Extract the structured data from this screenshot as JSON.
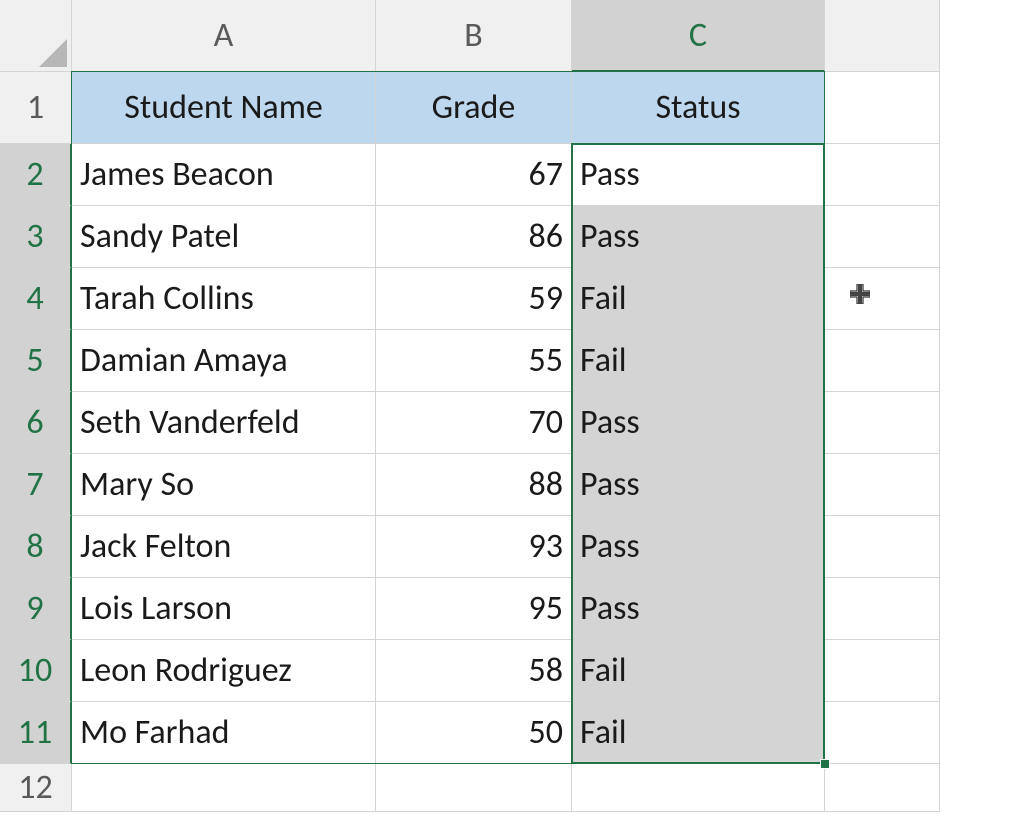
{
  "columns": [
    "A",
    "B",
    "C",
    ""
  ],
  "row_numbers": [
    "1",
    "2",
    "3",
    "4",
    "5",
    "6",
    "7",
    "8",
    "9",
    "10",
    "11",
    "12"
  ],
  "headers": {
    "name": "Student Name",
    "grade": "Grade",
    "status": "Status"
  },
  "students": [
    {
      "name": "James Beacon",
      "grade": "67",
      "status": "Pass"
    },
    {
      "name": "Sandy Patel",
      "grade": "86",
      "status": "Pass"
    },
    {
      "name": "Tarah Collins",
      "grade": "59",
      "status": "Fail"
    },
    {
      "name": "Damian Amaya",
      "grade": "55",
      "status": "Fail"
    },
    {
      "name": "Seth Vanderfeld",
      "grade": "70",
      "status": "Pass"
    },
    {
      "name": "Mary So",
      "grade": "88",
      "status": "Pass"
    },
    {
      "name": "Jack Felton",
      "grade": "93",
      "status": "Pass"
    },
    {
      "name": "Lois Larson",
      "grade": "95",
      "status": "Pass"
    },
    {
      "name": "Leon Rodriguez",
      "grade": "58",
      "status": "Fail"
    },
    {
      "name": "Mo Farhad",
      "grade": "50",
      "status": "Fail"
    }
  ],
  "active_column_index": 2,
  "active_row_start": 1,
  "active_row_end": 10,
  "colors": {
    "header_fill": "#bdd7ee",
    "selection_border": "#217346",
    "selection_fill": "#d4d4d4"
  }
}
